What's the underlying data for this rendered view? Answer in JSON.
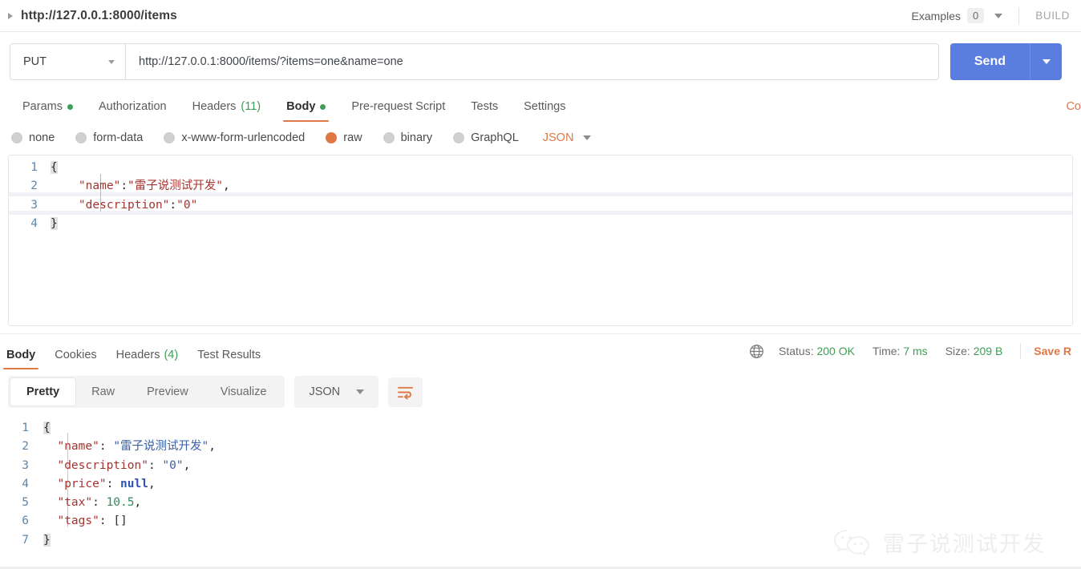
{
  "topbar": {
    "request_title": "http://127.0.0.1:8000/items",
    "examples_label": "Examples",
    "examples_count": "0",
    "build_label": "BUILD"
  },
  "url_row": {
    "method": "PUT",
    "url": "http://127.0.0.1:8000/items/?items=one&name=one",
    "send_label": "Send"
  },
  "request_tabs": [
    {
      "label": "Params",
      "dot": true
    },
    {
      "label": "Authorization",
      "dot": false
    },
    {
      "label": "Headers",
      "count": "(11)"
    },
    {
      "label": "Body",
      "dot": true,
      "active": true
    },
    {
      "label": "Pre-request Script"
    },
    {
      "label": "Tests"
    },
    {
      "label": "Settings"
    }
  ],
  "request_tabs_cutoff": "Co",
  "body_types": [
    {
      "label": "none",
      "selected": false
    },
    {
      "label": "form-data",
      "selected": false
    },
    {
      "label": "x-www-form-urlencoded",
      "selected": false
    },
    {
      "label": "raw",
      "selected": true
    },
    {
      "label": "binary",
      "selected": false
    },
    {
      "label": "GraphQL",
      "selected": false
    }
  ],
  "body_format": "JSON",
  "request_body": {
    "lines": [
      {
        "n": "1",
        "text": "{"
      },
      {
        "n": "2",
        "text": "    \"name\":\"雷子说测试开发\","
      },
      {
        "n": "3",
        "text": "    \"description\":\"0\""
      },
      {
        "n": "4",
        "text": "}"
      }
    ]
  },
  "response_tabs": [
    {
      "label": "Body",
      "active": true
    },
    {
      "label": "Cookies"
    },
    {
      "label": "Headers",
      "count": "(4)"
    },
    {
      "label": "Test Results"
    }
  ],
  "response_meta": {
    "status_label": "Status:",
    "status_value": "200 OK",
    "time_label": "Time:",
    "time_value": "7 ms",
    "size_label": "Size:",
    "size_value": "209 B",
    "save_response": "Save R"
  },
  "view_modes": [
    {
      "label": "Pretty",
      "active": true
    },
    {
      "label": "Raw"
    },
    {
      "label": "Preview"
    },
    {
      "label": "Visualize"
    }
  ],
  "response_format": "JSON",
  "response_body": {
    "lines": [
      {
        "n": "1",
        "text": "{"
      },
      {
        "n": "2",
        "text": "    \"name\": \"雷子说测试开发\","
      },
      {
        "n": "3",
        "text": "    \"description\": \"0\","
      },
      {
        "n": "4",
        "text": "    \"price\": null,"
      },
      {
        "n": "5",
        "text": "    \"tax\": 10.5,"
      },
      {
        "n": "6",
        "text": "    \"tags\": []"
      },
      {
        "n": "7",
        "text": "}"
      }
    ]
  },
  "watermark": {
    "text": "雷子说测试开发"
  },
  "colors": {
    "accent_orange": "#e07845",
    "send_blue": "#5a7de0",
    "status_green": "#3f9e55",
    "json_key": "#a5332f",
    "json_string": "#3b5fa8",
    "json_number": "#2f8a5f",
    "json_null": "#2f52b5"
  }
}
